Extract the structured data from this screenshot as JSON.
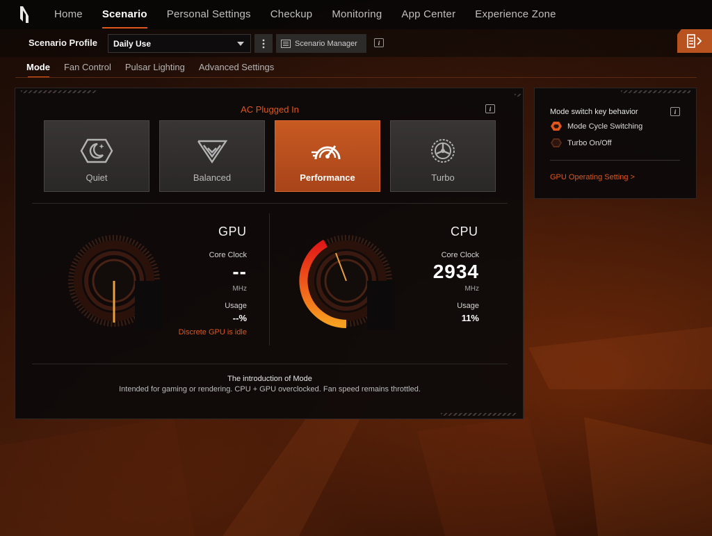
{
  "nav": {
    "items": [
      {
        "label": "Home"
      },
      {
        "label": "Scenario"
      },
      {
        "label": "Personal Settings"
      },
      {
        "label": "Checkup"
      },
      {
        "label": "Monitoring"
      },
      {
        "label": "App Center"
      },
      {
        "label": "Experience Zone"
      }
    ],
    "active": "Scenario"
  },
  "profile": {
    "label": "Scenario Profile",
    "selected": "Daily Use",
    "more_icon": "more-vertical-icon",
    "manager_label": "Scenario Manager",
    "manager_icon": "list-icon",
    "info_icon": "info-icon"
  },
  "subtabs": [
    {
      "label": "Mode"
    },
    {
      "label": "Fan Control"
    },
    {
      "label": "Pulsar Lighting"
    },
    {
      "label": "Advanced Settings"
    }
  ],
  "mode_panel": {
    "power_state": "AC Plugged In",
    "modes": [
      {
        "label": "Quiet",
        "icon": "moon-icon",
        "active": false
      },
      {
        "label": "Balanced",
        "icon": "chevron-shield-icon",
        "active": false
      },
      {
        "label": "Performance",
        "icon": "speedometer-icon",
        "active": true
      },
      {
        "label": "Turbo",
        "icon": "turbo-fan-icon",
        "active": false
      }
    ],
    "gpu": {
      "title": "GPU",
      "clock_label": "Core Clock",
      "clock_value": "--",
      "clock_unit": "MHz",
      "usage_label": "Usage",
      "usage_value": "--%",
      "status": "Discrete GPU is idle",
      "usage_fraction": 0
    },
    "cpu": {
      "title": "CPU",
      "clock_label": "Core Clock",
      "clock_value": "2934",
      "clock_unit": "MHz",
      "usage_label": "Usage",
      "usage_value": "11%",
      "usage_fraction": 0.11
    },
    "intro_title": "The introduction of Mode",
    "intro_desc": "Intended for gaming or rendering. CPU + GPU overclocked. Fan speed remains throttled."
  },
  "side_panel": {
    "title": "Mode switch key behavior",
    "options": [
      {
        "label": "Mode Cycle Switching",
        "selected": true
      },
      {
        "label": "Turbo On/Off",
        "selected": false
      }
    ],
    "gpu_link": "GPU Operating Setting >"
  },
  "colors": {
    "accent": "#e0561b",
    "active_card": "#c85a22",
    "panel_bg": "#0c0a0a"
  }
}
